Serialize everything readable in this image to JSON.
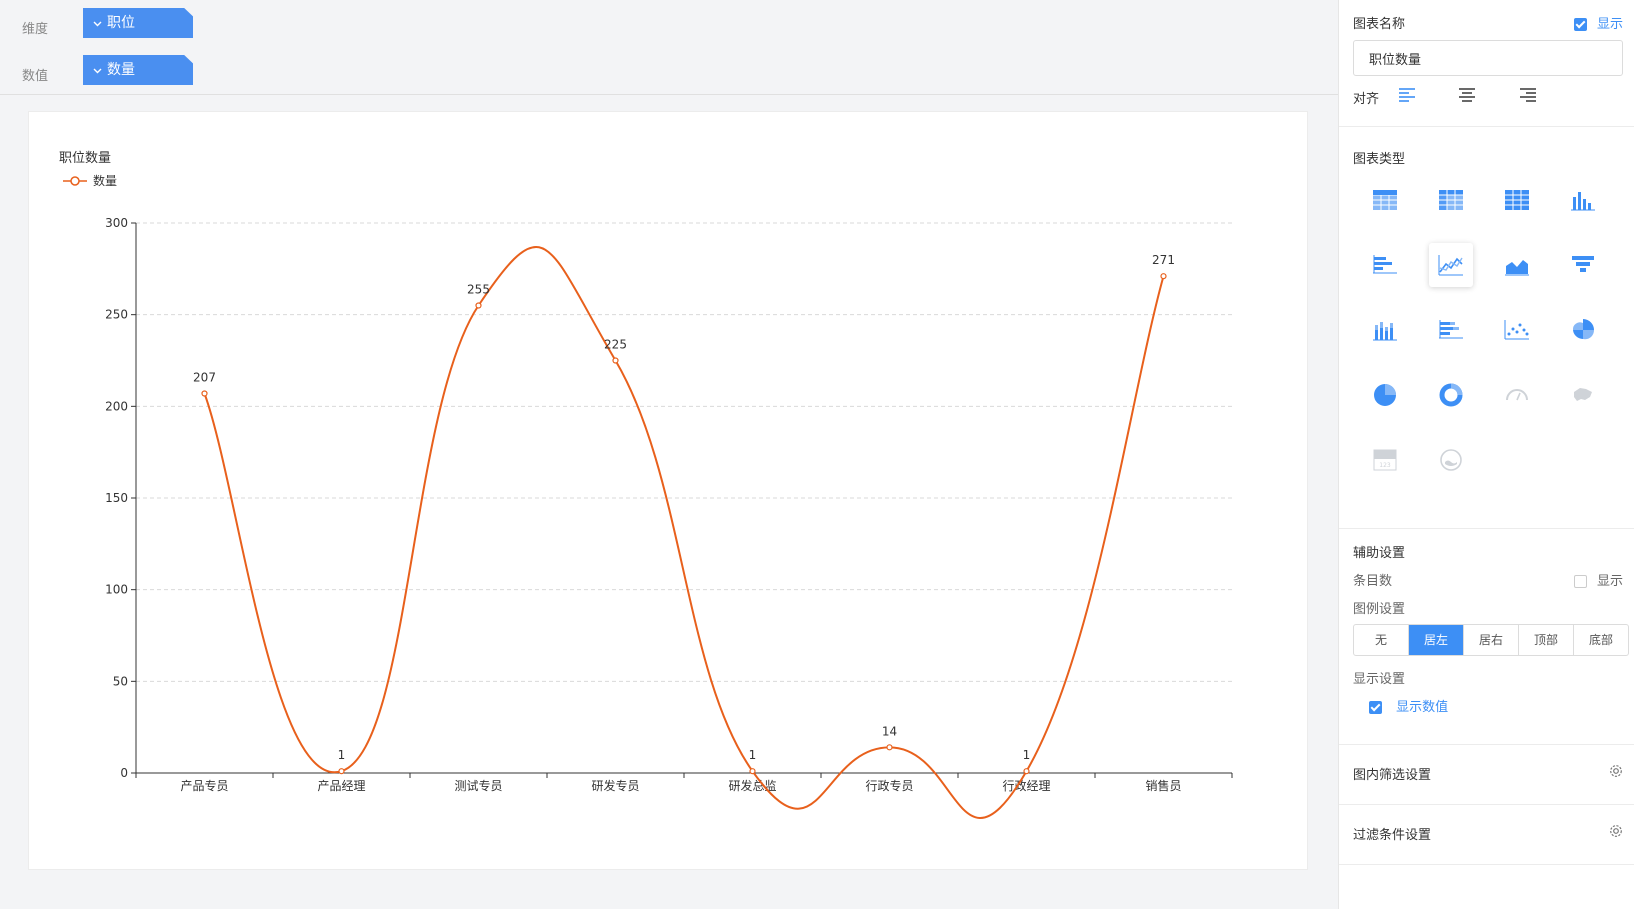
{
  "toolbar": {
    "dimension_label": "维度",
    "dimension_value": "职位",
    "measure_label": "数值",
    "measure_value": "数量"
  },
  "chart_data": {
    "type": "line",
    "title": "职位数量",
    "legend": "top-left",
    "categories": [
      "产品专员",
      "产品经理",
      "测试专员",
      "研发专员",
      "研发总监",
      "行政专员",
      "行政经理",
      "销售员"
    ],
    "series": [
      {
        "name": "数量",
        "values": [
          207,
          1,
          255,
          225,
          1,
          14,
          1,
          271
        ],
        "color": "#e8601c"
      }
    ],
    "ylim": [
      0,
      300
    ],
    "yticks": [
      0,
      50,
      100,
      150,
      200,
      250,
      300
    ],
    "smooth": true,
    "grid": true,
    "show_values": true
  },
  "panel": {
    "chart_name_label": "图表名称",
    "show_label": "显示",
    "chart_name_value": "职位数量",
    "align_label": "对齐",
    "chart_type_label": "图表类型",
    "chart_types": [
      {
        "icon": "table-icon",
        "active": false
      },
      {
        "icon": "pivot-table-icon",
        "active": false
      },
      {
        "icon": "cross-table-icon",
        "active": false
      },
      {
        "icon": "column-chart-icon",
        "active": false
      },
      {
        "icon": "bar-chart-icon",
        "active": false
      },
      {
        "icon": "line-chart-icon",
        "active": true
      },
      {
        "icon": "area-chart-icon",
        "active": false
      },
      {
        "icon": "funnel-chart-icon",
        "active": false
      },
      {
        "icon": "stacked-column-icon",
        "active": false
      },
      {
        "icon": "stacked-bar-icon",
        "active": false
      },
      {
        "icon": "scatter-chart-icon",
        "active": false
      },
      {
        "icon": "rose-chart-icon",
        "active": false
      },
      {
        "icon": "pie-chart-icon",
        "active": false
      },
      {
        "icon": "donut-chart-icon",
        "active": false
      },
      {
        "icon": "gauge-chart-icon",
        "active": false
      },
      {
        "icon": "map-chart-icon",
        "active": false
      },
      {
        "icon": "kpi-card-icon",
        "active": false
      },
      {
        "icon": "liquid-chart-icon",
        "active": false
      }
    ],
    "aux_settings_label": "辅助设置",
    "item_count_label": "条目数",
    "item_count_show_label": "显示",
    "legend_settings_label": "图例设置",
    "legend_options": [
      "无",
      "居左",
      "居右",
      "顶部",
      "底部"
    ],
    "legend_selected": "居左",
    "display_settings_label": "显示设置",
    "show_values_label": "显示数值",
    "inner_filter_label": "图内筛选设置",
    "filter_condition_label": "过滤条件设置"
  },
  "colors": {
    "accent": "#3d8ff5",
    "pill": "#4a8ff0",
    "line": "#e8601c"
  }
}
